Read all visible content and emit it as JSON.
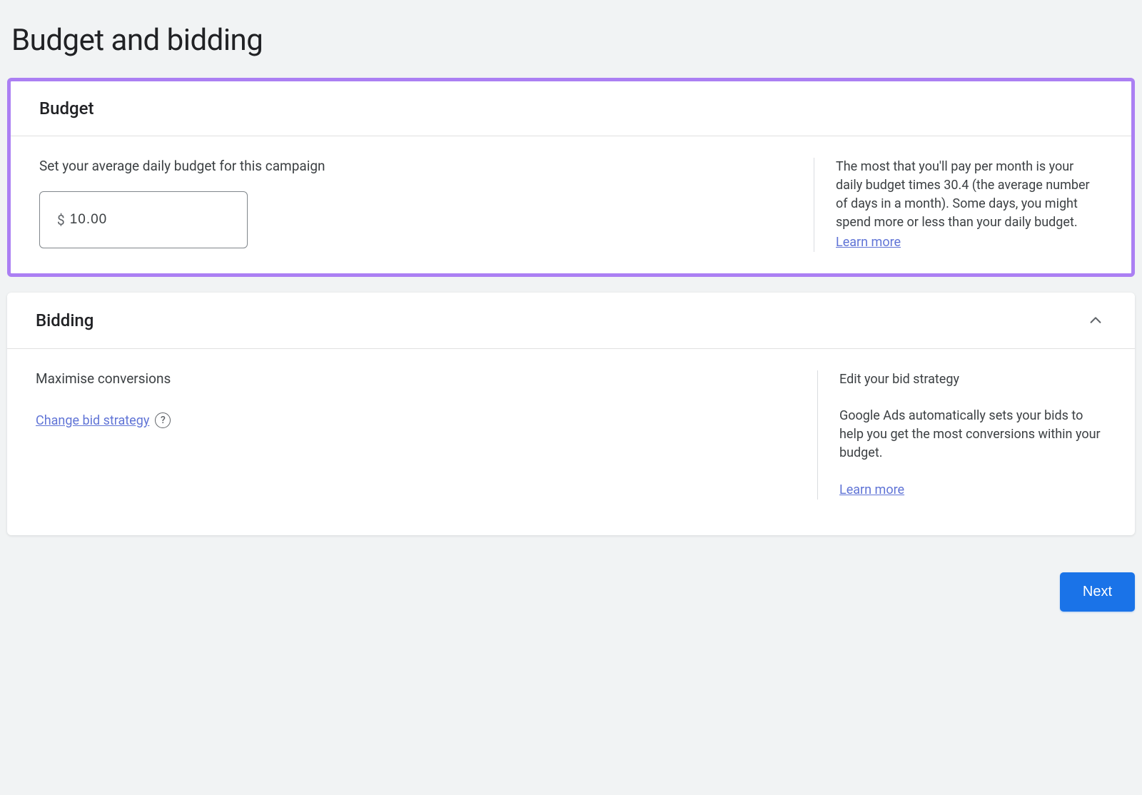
{
  "heading": "Budget and bidding",
  "budget": {
    "title": "Budget",
    "instruction": "Set your average daily budget for this campaign",
    "currency": "$",
    "value": "10.00",
    "info": "The most that you'll pay per month is your daily budget times 30.4 (the average number of days in a month). Some days, you might spend more or less than your daily budget.",
    "learn_more": "Learn more"
  },
  "bidding": {
    "title": "Bidding",
    "current_strategy": "Maximise conversions",
    "change_link": "Change bid strategy",
    "right_heading": "Edit your bid strategy",
    "right_para": "Google Ads automatically sets your bids to help you get the most conversions within your budget.",
    "learn_more": "Learn more"
  },
  "footer": {
    "next": "Next"
  }
}
